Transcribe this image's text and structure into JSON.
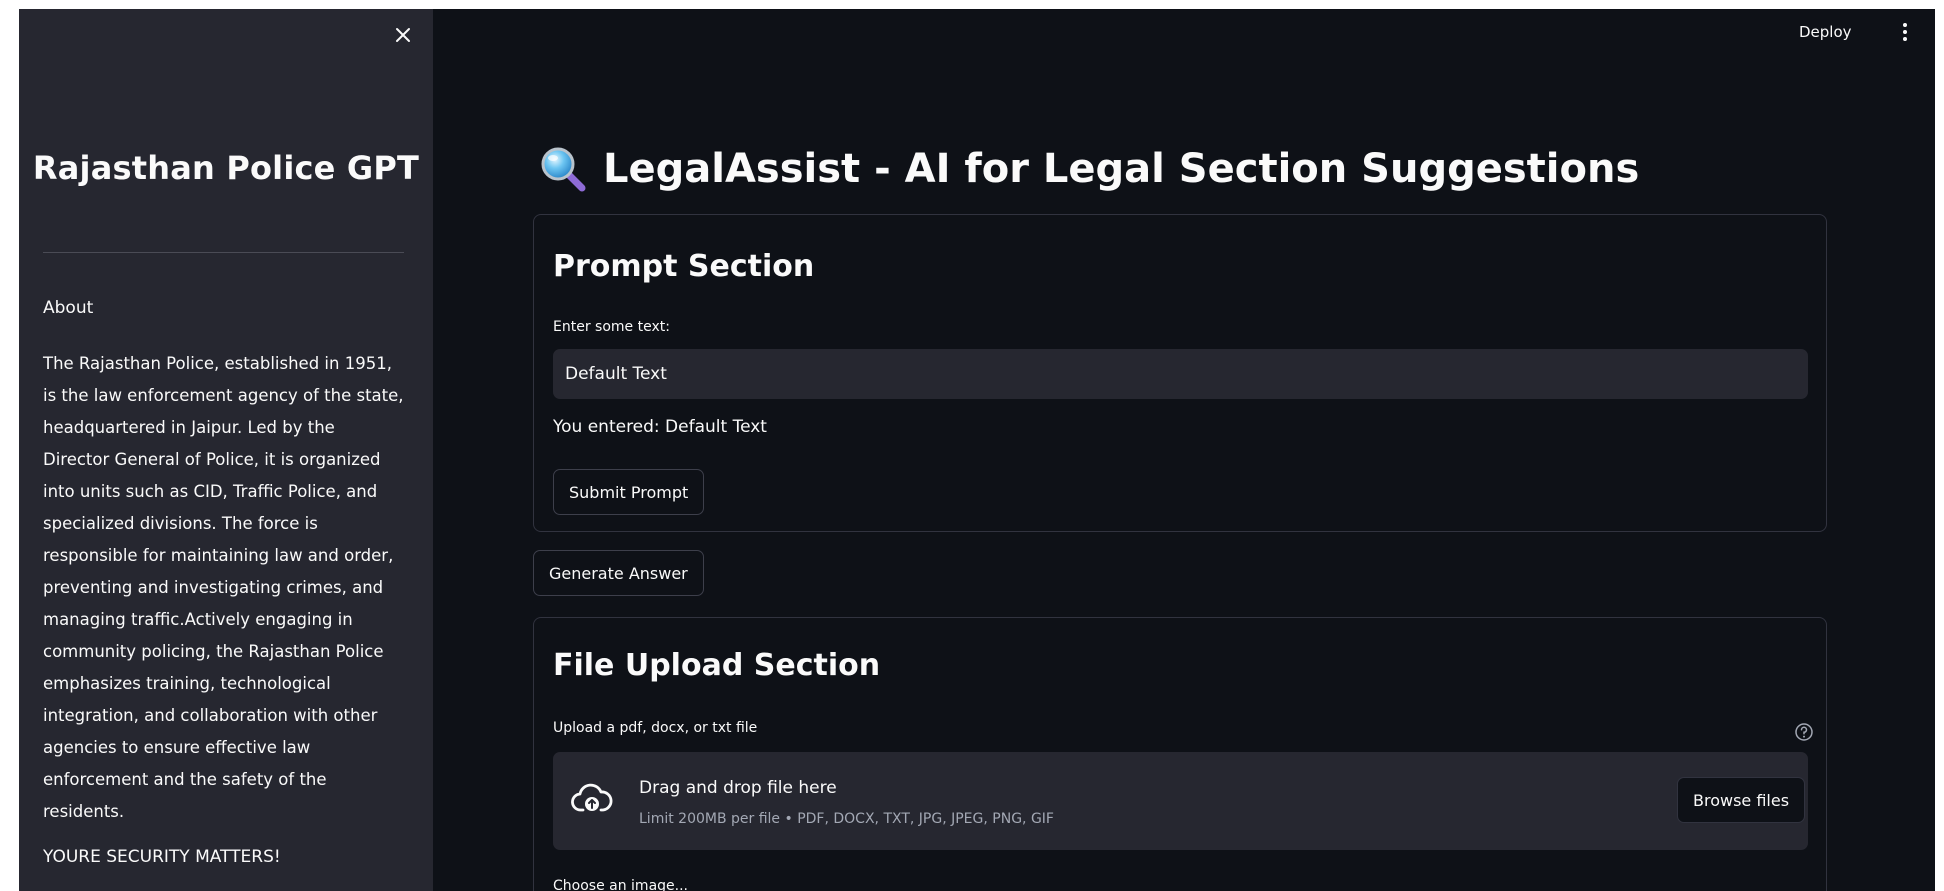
{
  "sidebar": {
    "title": "Rajasthan Police GPT",
    "about_label": "About",
    "about_lines": [
      "The Rajasthan Police, established in 1951,",
      "is the law enforcement agency of the state,",
      "headquartered in Jaipur. Led by the",
      "Director General of Police, it is organized",
      "into units such as CID, Traffic Police, and",
      "specialized divisions. The force is",
      "responsible for maintaining law and order,",
      "preventing and investigating crimes, and",
      "managing traffic.Actively engaging in",
      "community policing, the Rajasthan Police",
      "emphasizes training, technological",
      "integration, and collaboration with other",
      "agencies to ensure effective law",
      "enforcement and the safety of the",
      "residents."
    ],
    "security_text": "YOURE SECURITY MATTERS!",
    "close_icon": "close-icon"
  },
  "header": {
    "deploy_label": "Deploy",
    "menu_icon": "kebab-menu-icon"
  },
  "main": {
    "title": "LegalAssist - AI for Legal Section Suggestions",
    "title_icon": "magnifying-glass-icon",
    "prompt_section": {
      "heading": "Prompt Section",
      "input_label": "Enter some text:",
      "input_value": "Default Text",
      "echo": "You entered: Default Text",
      "submit_label": "Submit Prompt"
    },
    "generate_label": "Generate Answer",
    "upload_section": {
      "heading": "File Upload Section",
      "upload_label": "Upload a pdf, docx, or txt file",
      "drop_title": "Drag and drop file here",
      "drop_limit": "Limit 200MB per file • PDF, DOCX, TXT, JPG, JPEG, PNG, GIF",
      "browse_label": "Browse files",
      "image_label": "Choose an image..."
    }
  },
  "colors": {
    "app_bg": "#0e1117",
    "sidebar_bg": "#262730",
    "text": "#fafafa",
    "muted_text": "#a3a8b4",
    "border": "#31333f"
  }
}
